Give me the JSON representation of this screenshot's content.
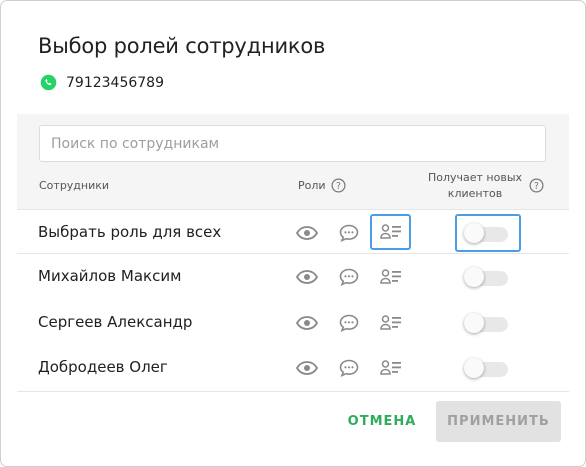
{
  "dialog": {
    "title": "Выбор ролей сотрудников",
    "phone": "79123456789"
  },
  "search": {
    "placeholder": "Поиск по сотрудникам",
    "value": ""
  },
  "table": {
    "col_employees": "Сотрудники",
    "col_roles": "Роли",
    "col_new_clients_line1": "Получает новых",
    "col_new_clients_line2": "клиентов",
    "rows": [
      {
        "name": "Выбрать роль для всех",
        "receives_new_clients": false
      },
      {
        "name": "Михайлов Максим",
        "receives_new_clients": false
      },
      {
        "name": "Сергеев Александр",
        "receives_new_clients": false
      },
      {
        "name": "Добродеев Олег",
        "receives_new_clients": false
      }
    ]
  },
  "footer": {
    "cancel_label": "ОТМЕНА",
    "apply_label": "ПРИМЕНИТЬ"
  },
  "colors": {
    "accent_green": "#2ead5b",
    "focus_blue": "#4a9ee6",
    "whatsapp": "#25d366"
  },
  "icons": [
    "whatsapp-icon",
    "help-icon",
    "eye-icon",
    "chat-icon",
    "contact-list-icon"
  ]
}
